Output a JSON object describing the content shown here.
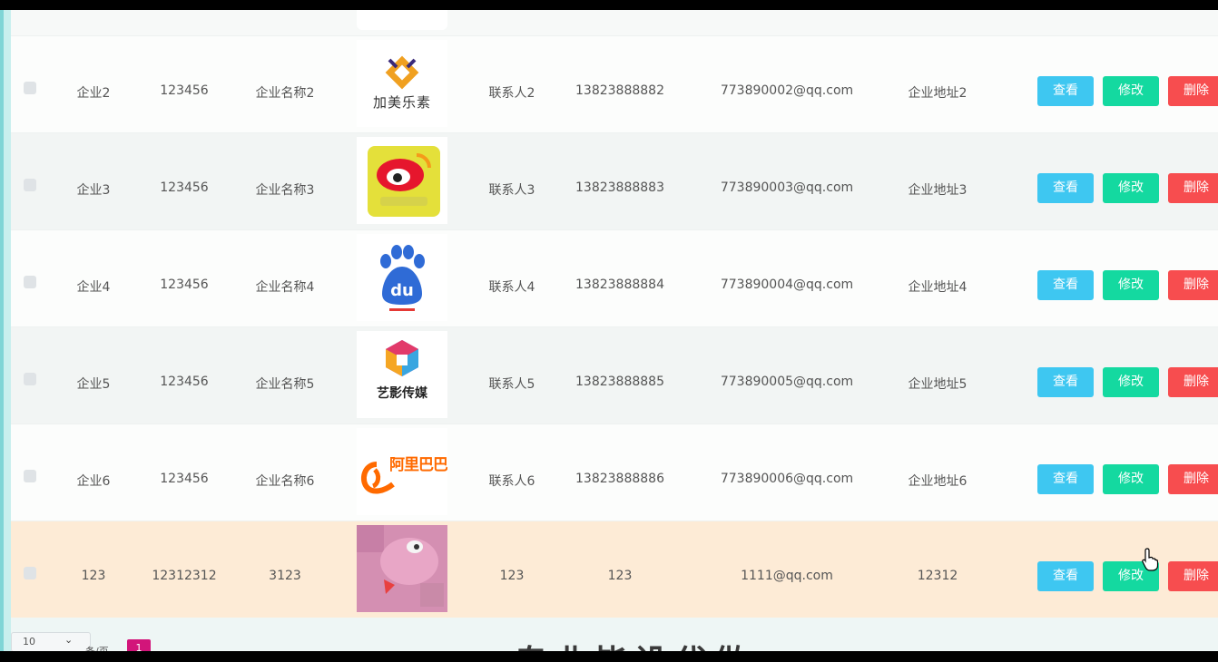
{
  "table": {
    "partial_top_row": {},
    "rows": [
      {
        "name": "企业2",
        "password": "123456",
        "company": "企业名称2",
        "logo": "jiamei-logo",
        "contact": "联系人2",
        "phone": "13823888882",
        "email": "773890002@qq.com",
        "address": "企业地址2",
        "logo_text": "加美乐素"
      },
      {
        "name": "企业3",
        "password": "123456",
        "company": "企业名称3",
        "logo": "weibo-logo",
        "contact": "联系人3",
        "phone": "13823888883",
        "email": "773890003@qq.com",
        "address": "企业地址3"
      },
      {
        "name": "企业4",
        "password": "123456",
        "company": "企业名称4",
        "logo": "baidu-logo",
        "contact": "联系人4",
        "phone": "13823888884",
        "email": "773890004@qq.com",
        "address": "企业地址4",
        "logo_text": "du"
      },
      {
        "name": "企业5",
        "password": "123456",
        "company": "企业名称5",
        "logo": "yiying-logo",
        "contact": "联系人5",
        "phone": "13823888885",
        "email": "773890005@qq.com",
        "address": "企业地址5",
        "logo_text": "艺影传媒"
      },
      {
        "name": "企业6",
        "password": "123456",
        "company": "企业名称6",
        "logo": "alibaba-logo",
        "contact": "联系人6",
        "phone": "13823888886",
        "email": "773890006@qq.com",
        "address": "企业地址6",
        "logo_text": "阿里巴巴"
      },
      {
        "name": "123",
        "password": "12312312",
        "company": "3123",
        "logo": "pink-photo",
        "contact": "123",
        "phone": "123",
        "email": "1111@qq.com",
        "address": "12312"
      }
    ],
    "actions": {
      "view": "查看",
      "edit": "修改",
      "delete": "删除"
    }
  },
  "pager": {
    "page_size": "10",
    "page_size_suffix": "条/页",
    "current_page": "1"
  },
  "watermark": {
    "text": "专业毕设代做"
  },
  "colors": {
    "view": "#3ec7f1",
    "edit": "#14d9a0",
    "delete": "#f74d4f",
    "highlight_row": "#fdebd6",
    "page_active": "#d2157a"
  }
}
